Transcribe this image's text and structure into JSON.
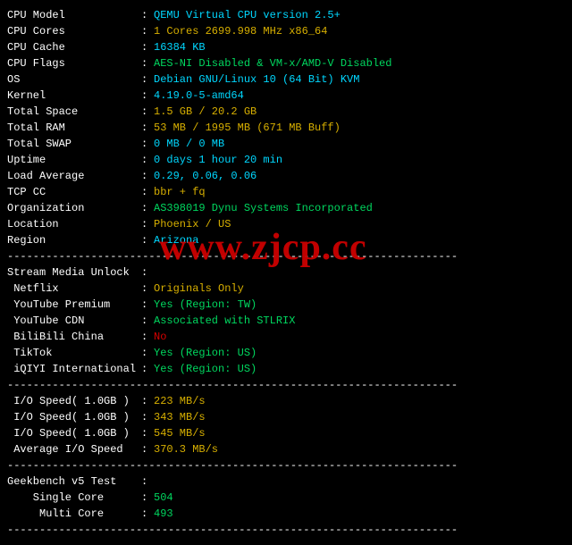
{
  "sysinfo": {
    "rows": [
      {
        "label": "CPU Model",
        "value": "QEMU Virtual CPU version 2.5+",
        "cls": "cyan"
      },
      {
        "label": "CPU Cores",
        "value": "1 Cores 2699.998 MHz x86_64",
        "cls": "yellow"
      },
      {
        "label": "CPU Cache",
        "value": "16384 KB",
        "cls": "cyan"
      },
      {
        "label": "CPU Flags",
        "value": "AES-NI Disabled & VM-x/AMD-V Disabled",
        "cls": "green"
      },
      {
        "label": "OS",
        "value": "Debian GNU/Linux 10 (64 Bit) KVM",
        "cls": "cyan"
      },
      {
        "label": "Kernel",
        "value": "4.19.0-5-amd64",
        "cls": "cyan"
      },
      {
        "label": "Total Space",
        "value": "1.5 GB / 20.2 GB",
        "cls": "yellow"
      },
      {
        "label": "Total RAM",
        "value": "53 MB / 1995 MB (671 MB Buff)",
        "cls": "yellow"
      },
      {
        "label": "Total SWAP",
        "value": "0 MB / 0 MB",
        "cls": "cyan"
      },
      {
        "label": "Uptime",
        "value": "0 days 1 hour 20 min",
        "cls": "cyan"
      },
      {
        "label": "Load Average",
        "value": "0.29, 0.06, 0.06",
        "cls": "cyan"
      },
      {
        "label": "TCP CC",
        "value": "bbr + fq",
        "cls": "yellow"
      },
      {
        "label": "Organization",
        "value": "AS398019 Dynu Systems Incorporated",
        "cls": "green"
      },
      {
        "label": "Location",
        "value": "Phoenix / US",
        "cls": "yellow"
      },
      {
        "label": "Region",
        "value": "Arizona",
        "cls": "cyan"
      }
    ]
  },
  "stream": {
    "header": "Stream Media Unlock",
    "rows": [
      {
        "label": " Netflix",
        "value": "Originals Only",
        "cls": "yellow"
      },
      {
        "label": " YouTube Premium",
        "value": "Yes (Region: TW)",
        "cls": "green"
      },
      {
        "label": " YouTube CDN",
        "value": "Associated with STLRIX",
        "cls": "green"
      },
      {
        "label": " BiliBili China",
        "value": "No",
        "cls": "red"
      },
      {
        "label": " TikTok",
        "value": "Yes (Region: US)",
        "cls": "green"
      },
      {
        "label": " iQIYI International",
        "value": "Yes (Region: US)",
        "cls": "green"
      }
    ]
  },
  "io": {
    "rows": [
      {
        "label": " I/O Speed( 1.0GB )",
        "value": "223 MB/s",
        "cls": "yellow"
      },
      {
        "label": " I/O Speed( 1.0GB )",
        "value": "343 MB/s",
        "cls": "yellow"
      },
      {
        "label": " I/O Speed( 1.0GB )",
        "value": "545 MB/s",
        "cls": "yellow"
      },
      {
        "label": " Average I/O Speed",
        "value": "370.3 MB/s",
        "cls": "yellow"
      }
    ]
  },
  "geekbench": {
    "header": "Geekbench v5 Test",
    "rows": [
      {
        "label": "    Single Core",
        "value": "504",
        "cls": "green"
      },
      {
        "label": "     Multi Core",
        "value": "493",
        "cls": "green"
      }
    ]
  },
  "divider": "----------------------------------------------------------------------",
  "watermark": "www.zjcp.cc"
}
